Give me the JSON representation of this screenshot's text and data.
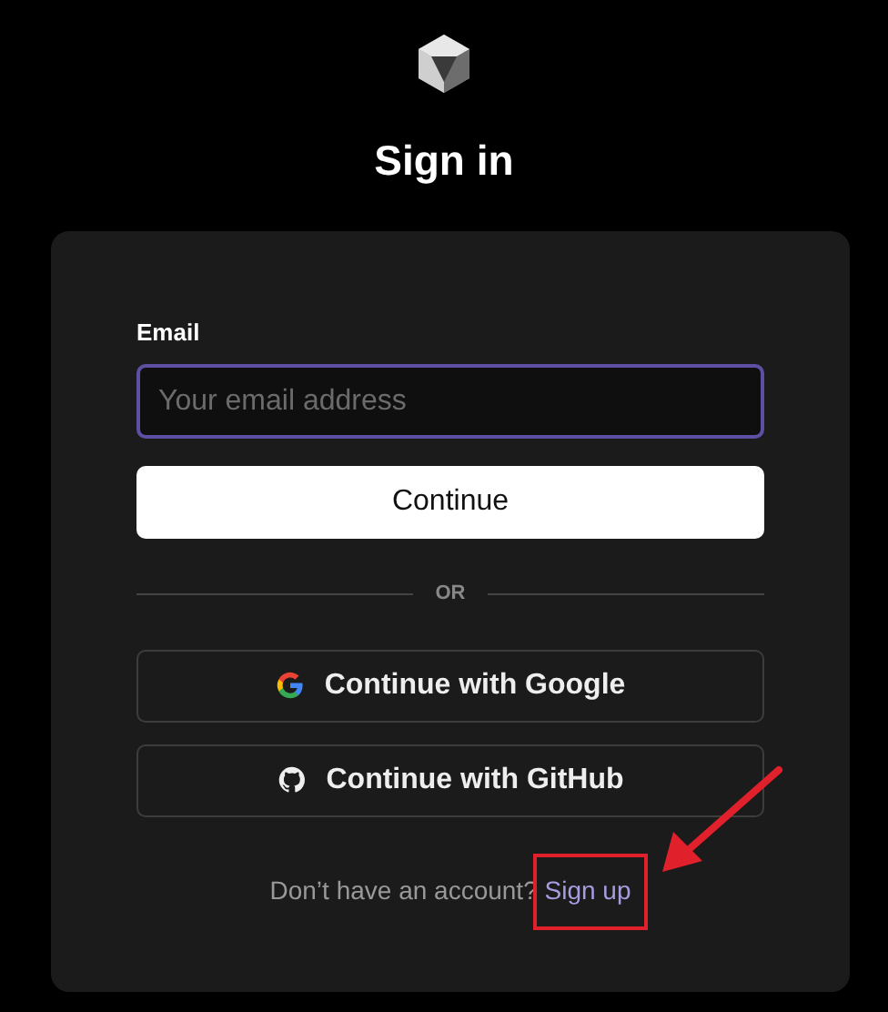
{
  "title": "Sign in",
  "email": {
    "label": "Email",
    "placeholder": "Your email address",
    "focused": true
  },
  "continue_button": "Continue",
  "divider": "OR",
  "providers": [
    {
      "kind": "google",
      "label": "Continue with Google"
    },
    {
      "kind": "github",
      "label": "Continue with GitHub"
    }
  ],
  "footer": {
    "text": "Don’t have an account?",
    "link": "Sign up",
    "highlighted": true
  }
}
